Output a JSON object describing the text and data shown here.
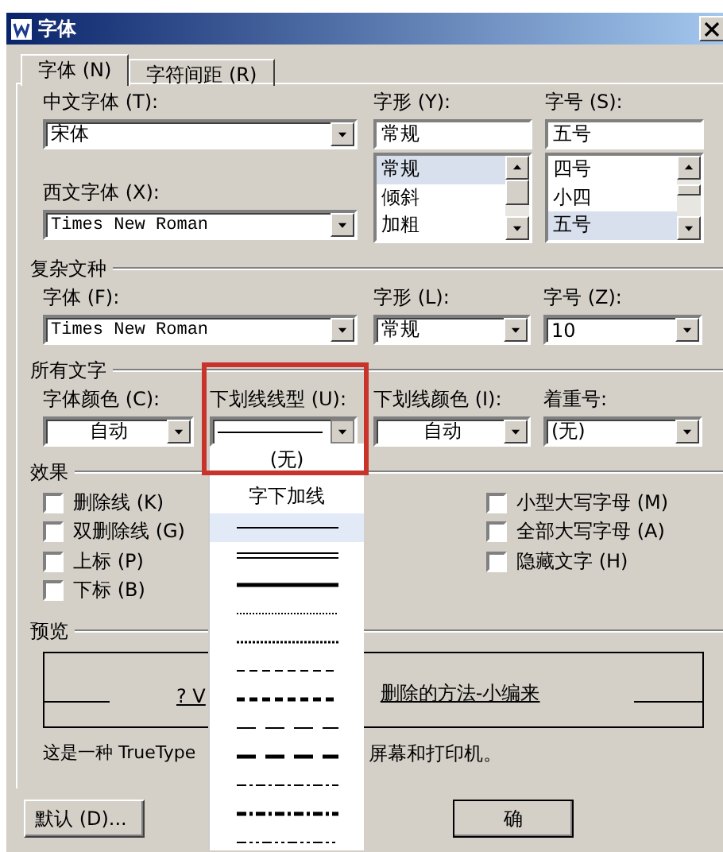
{
  "window": {
    "title": "字体"
  },
  "tabs": [
    {
      "label": "字体 (N)",
      "selected": true
    },
    {
      "label": "字符间距 (R)",
      "selected": false
    }
  ],
  "chinese_font": {
    "label": "中文字体 (T):",
    "value": "宋体"
  },
  "font_style": {
    "label": "字形 (Y):",
    "value": "常规",
    "options": [
      {
        "label": "常规",
        "selected": true
      },
      {
        "label": "倾斜",
        "selected": false
      },
      {
        "label": "加粗",
        "selected": false
      }
    ]
  },
  "font_size": {
    "label": "字号 (S):",
    "value": "五号",
    "options": [
      {
        "label": "四号",
        "selected": false
      },
      {
        "label": "小四",
        "selected": false
      },
      {
        "label": "五号",
        "selected": true
      }
    ]
  },
  "western_font": {
    "label": "西文字体 (X):",
    "value": "Times New Roman"
  },
  "complex_script": {
    "title": "复杂文种",
    "fields": [
      {
        "label": "字体 (F):",
        "value": "Times New Roman"
      },
      {
        "label": "字形 (L):",
        "value": "常规"
      },
      {
        "label": "字号 (Z):",
        "value": "10"
      }
    ]
  },
  "all_text": {
    "title": "所有文字",
    "fields": [
      {
        "kind": "text",
        "label": "字体颜色 (C):",
        "value": "自动",
        "centered": true
      },
      {
        "kind": "solid",
        "label": "下划线线型 (U):",
        "highlighted": true,
        "expanded": true
      },
      {
        "kind": "text",
        "label": "下划线颜色 (I):",
        "value": "自动",
        "centered": true
      },
      {
        "kind": "text",
        "label": "着重号:",
        "value": "(无)",
        "centered": false
      }
    ]
  },
  "underline_menu": [
    {
      "kind": "text",
      "label": "(无)",
      "selected": false
    },
    {
      "kind": "text",
      "label": "字下加线",
      "selected": false
    },
    {
      "kind": "solid",
      "selected": true
    },
    {
      "kind": "double",
      "selected": false
    },
    {
      "kind": "thick",
      "selected": false
    },
    {
      "kind": "dotted",
      "selected": false
    },
    {
      "kind": "heavydotted",
      "selected": false
    },
    {
      "kind": "dashed",
      "selected": false
    },
    {
      "kind": "heavydashed",
      "selected": false
    },
    {
      "kind": "longdash",
      "selected": false
    },
    {
      "kind": "heavylongdash",
      "selected": false
    },
    {
      "kind": "dashdot",
      "selected": false
    },
    {
      "kind": "heavydashdot",
      "selected": false
    },
    {
      "kind": "dashdotdot",
      "selected": false
    }
  ],
  "effects": {
    "title": "效果",
    "left": [
      {
        "label": "删除线 (K)",
        "checked": false
      },
      {
        "label": "双删除线 (G)",
        "checked": false
      },
      {
        "label": "上标 (P)",
        "checked": false
      },
      {
        "label": "下标 (B)",
        "checked": false
      }
    ],
    "right": [
      {
        "label": "小型大写字母 (M)",
        "checked": false
      },
      {
        "label": "全部大写字母 (A)",
        "checked": false
      },
      {
        "label": "隐藏文字 (H)",
        "checked": false
      }
    ]
  },
  "preview": {
    "title": "预览",
    "sample_start": "? V",
    "sample_end": "删除的方法-小编来",
    "note_start": "这是一种 TrueType",
    "note_end": "屏幕和打印机。"
  },
  "buttons": [
    {
      "label": "默认 (D)..."
    },
    {
      "label": "确"
    }
  ]
}
